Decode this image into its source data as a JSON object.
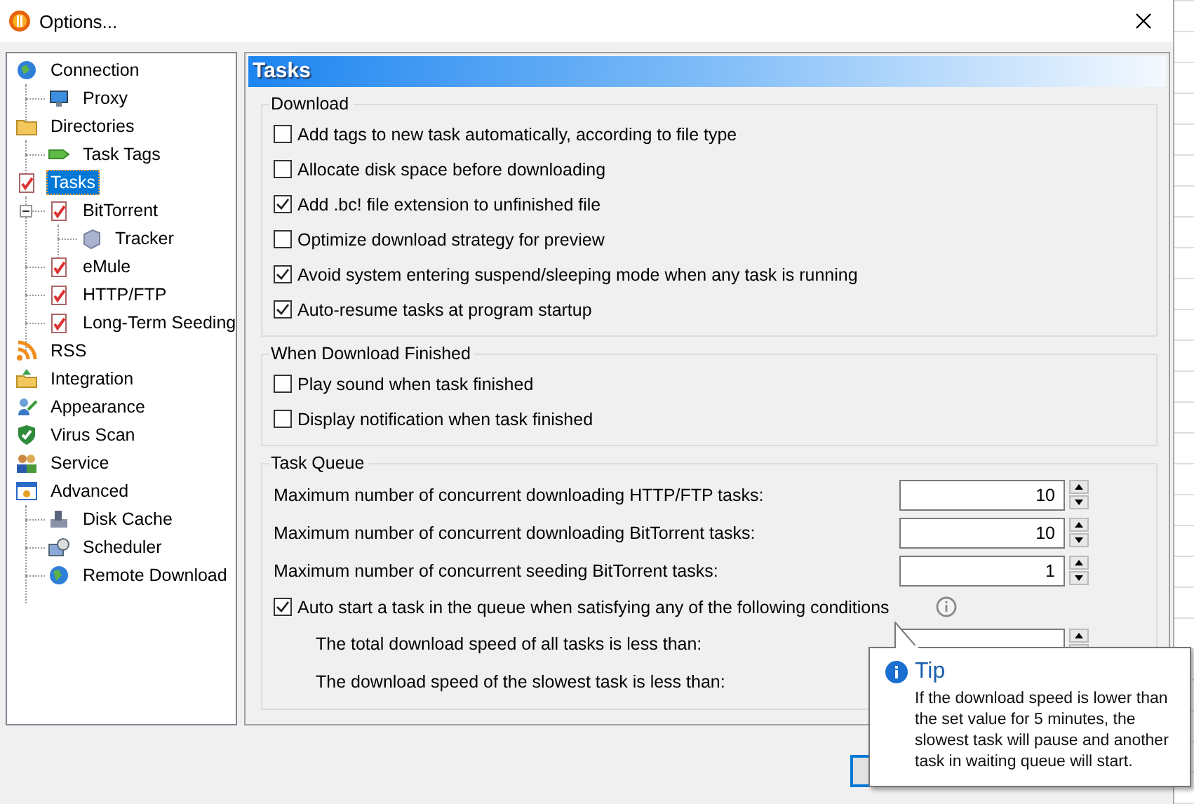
{
  "window": {
    "title": "Options..."
  },
  "tree": [
    {
      "label": "Connection",
      "selected": false,
      "children": [
        {
          "label": "Proxy",
          "selected": false
        }
      ]
    },
    {
      "label": "Directories",
      "selected": false,
      "children": [
        {
          "label": "Task Tags",
          "selected": false
        }
      ]
    },
    {
      "label": "Tasks",
      "selected": true,
      "children": [
        {
          "label": "BitTorrent",
          "selected": false,
          "expanded": true,
          "children": [
            {
              "label": "Tracker",
              "selected": false
            }
          ]
        },
        {
          "label": "eMule",
          "selected": false
        },
        {
          "label": "HTTP/FTP",
          "selected": false
        },
        {
          "label": "Long-Term Seeding",
          "selected": false
        }
      ]
    },
    {
      "label": "RSS",
      "selected": false
    },
    {
      "label": "Integration",
      "selected": false
    },
    {
      "label": "Appearance",
      "selected": false
    },
    {
      "label": "Virus Scan",
      "selected": false
    },
    {
      "label": "Service",
      "selected": false
    },
    {
      "label": "Advanced",
      "selected": false,
      "children": [
        {
          "label": "Disk Cache",
          "selected": false
        },
        {
          "label": "Scheduler",
          "selected": false
        },
        {
          "label": "Remote Download",
          "selected": false
        }
      ]
    }
  ],
  "panel": {
    "title": "Tasks",
    "groups": [
      {
        "title": "Download",
        "items": [
          {
            "kind": "checkbox",
            "label": "Add tags to new task automatically, according to file type",
            "checked": false
          },
          {
            "kind": "checkbox",
            "label": "Allocate disk space before downloading",
            "checked": false
          },
          {
            "kind": "checkbox",
            "label": "Add .bc! file extension to unfinished file",
            "checked": true
          },
          {
            "kind": "checkbox",
            "label": "Optimize download strategy for preview",
            "checked": false
          },
          {
            "kind": "checkbox",
            "label": "Avoid system entering suspend/sleeping mode when any task is running",
            "checked": true
          },
          {
            "kind": "checkbox",
            "label": "Auto-resume tasks at program startup",
            "checked": true
          }
        ]
      },
      {
        "title": "When Download Finished",
        "items": [
          {
            "kind": "checkbox",
            "label": "Play sound when task finished",
            "checked": false
          },
          {
            "kind": "checkbox",
            "label": "Display notification when task finished",
            "checked": false
          }
        ]
      },
      {
        "title": "Task Queue",
        "items": [
          {
            "kind": "spin",
            "label": "Maximum number of concurrent downloading HTTP/FTP tasks:",
            "value": "10"
          },
          {
            "kind": "spin",
            "label": "Maximum number of concurrent downloading BitTorrent tasks:",
            "value": "10"
          },
          {
            "kind": "spin",
            "label": "Maximum number of concurrent seeding BitTorrent tasks:",
            "value": "1"
          },
          {
            "kind": "checkbox",
            "label": "Auto start a task in the queue when satisfying any of the following conditions",
            "checked": true,
            "info_icon": true
          },
          {
            "kind": "condition",
            "label": "The total download speed of all tasks is less than:"
          },
          {
            "kind": "text",
            "label": "The download speed of the slowest task is less than:"
          }
        ]
      }
    ]
  },
  "tooltip": {
    "title": "Tip",
    "text": "If the download speed is lower than the set value for 5 minutes, the slowest task will pause and another task in waiting queue will start."
  }
}
